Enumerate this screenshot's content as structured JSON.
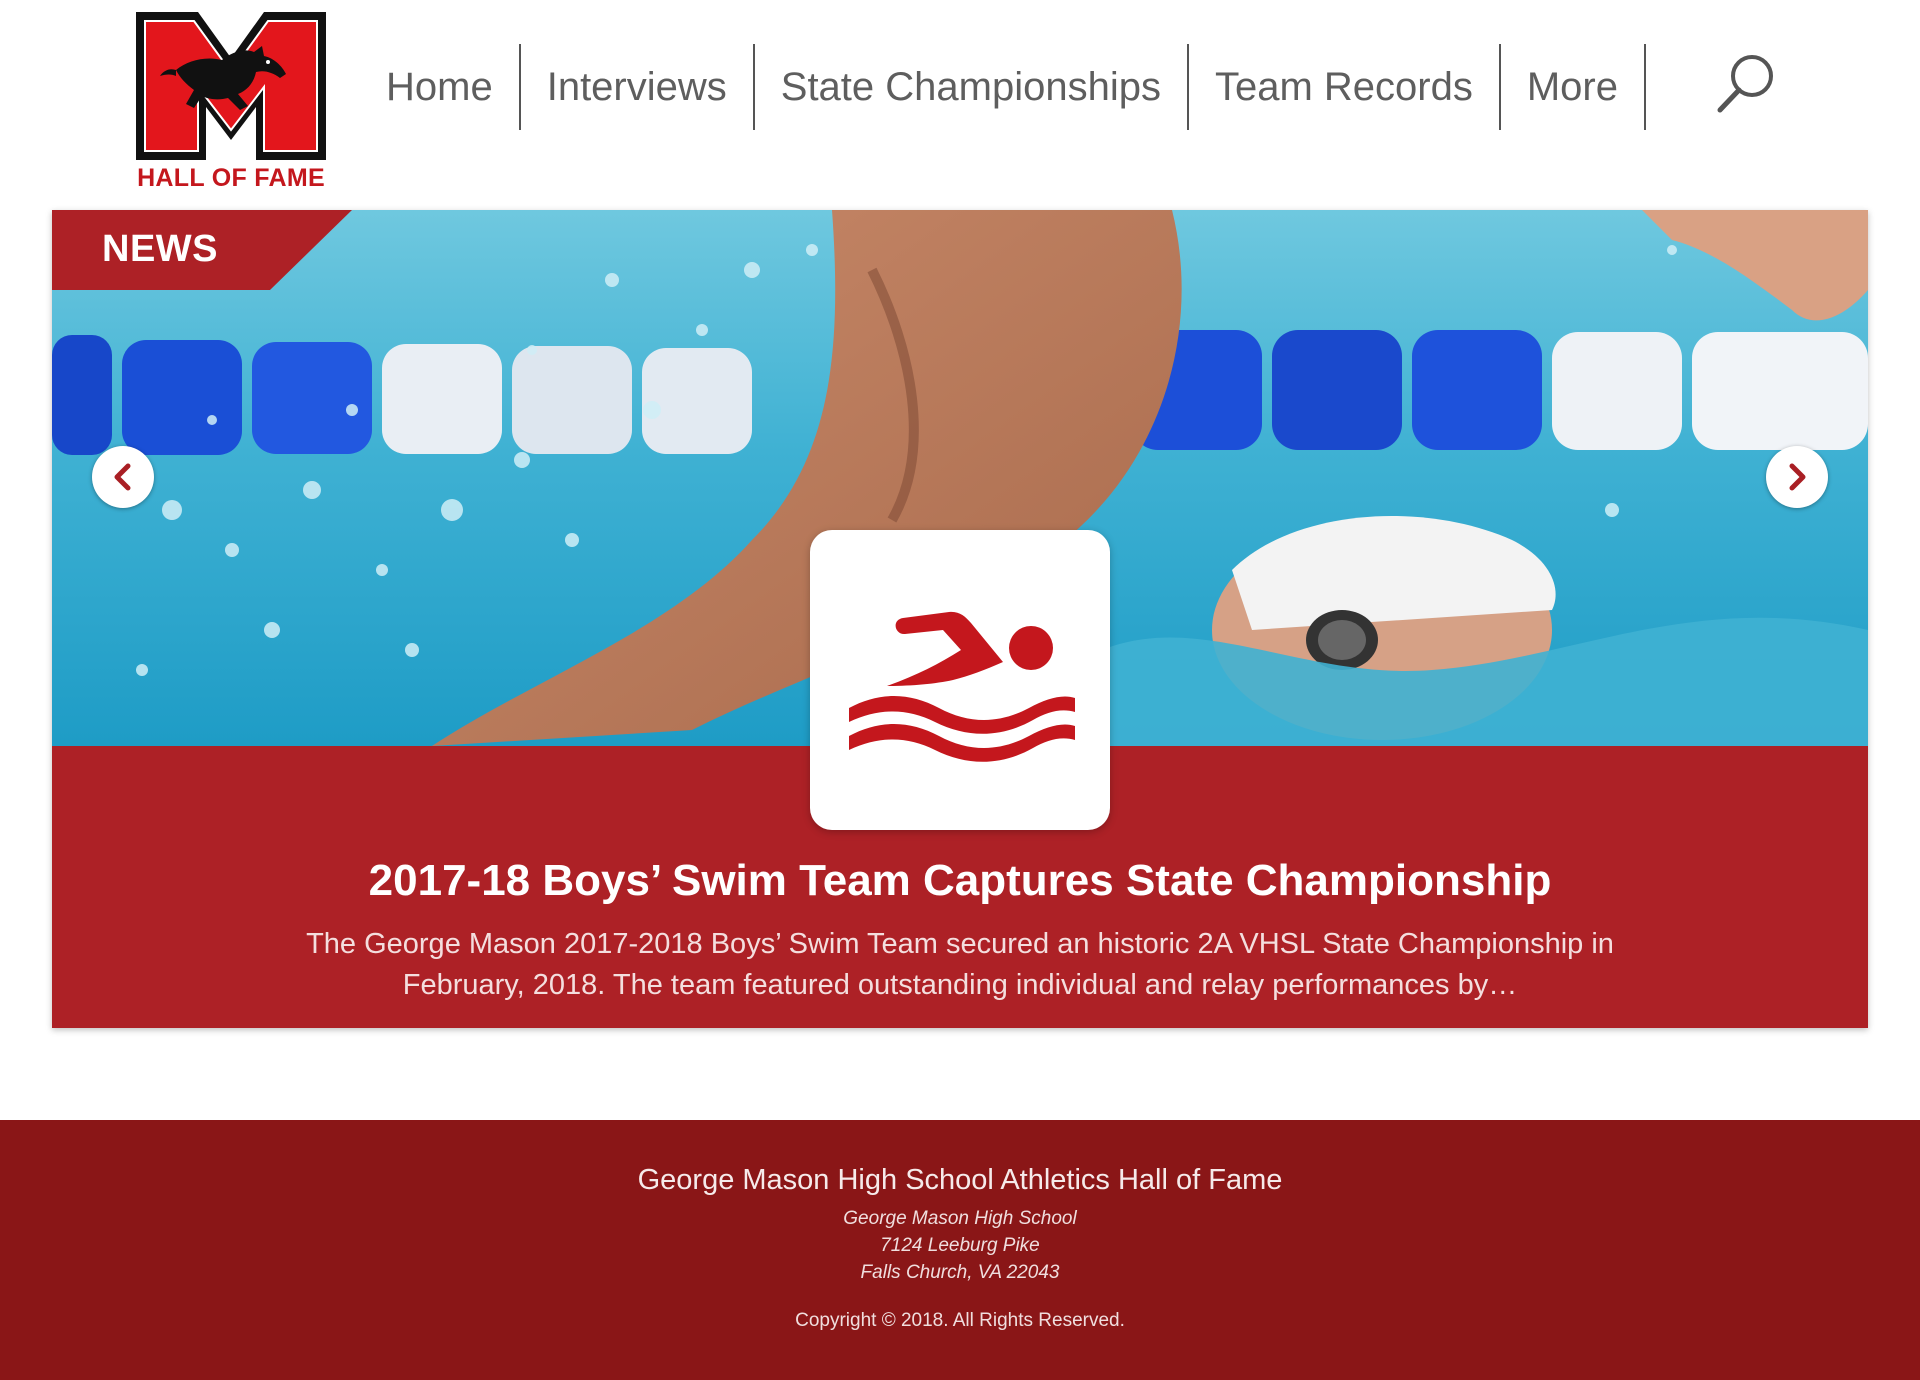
{
  "logo": {
    "text": "HALL OF FAME",
    "letter": "M"
  },
  "nav": {
    "items": [
      {
        "label": "Home"
      },
      {
        "label": "Interviews"
      },
      {
        "label": "State Championships"
      },
      {
        "label": "Team Records"
      },
      {
        "label": "More"
      }
    ],
    "search_icon": "search-icon"
  },
  "carousel": {
    "tag": "NEWS",
    "sport_icon": "swimmer-icon",
    "headline": "2017-18 Boys’ Swim Team Captures State Championship",
    "summary": "The George Mason 2017-2018 Boys’ Swim Team secured an historic 2A VHSL State Championship in February, 2018. The team featured outstanding individual and relay performances by…",
    "prev_icon": "chevron-left-icon",
    "next_icon": "chevron-right-icon"
  },
  "footer": {
    "title": "George Mason High School Athletics Hall of Fame",
    "school": "George Mason High School",
    "street": "7124 Leeburg Pike",
    "city": "Falls Church, VA 22043",
    "copyright": "Copyright © 2018. All Rights Reserved."
  },
  "colors": {
    "brand_red": "#c4171d",
    "card_red": "#ad2126",
    "footer_red": "#8a1617",
    "nav_text": "#5e5e5e"
  }
}
